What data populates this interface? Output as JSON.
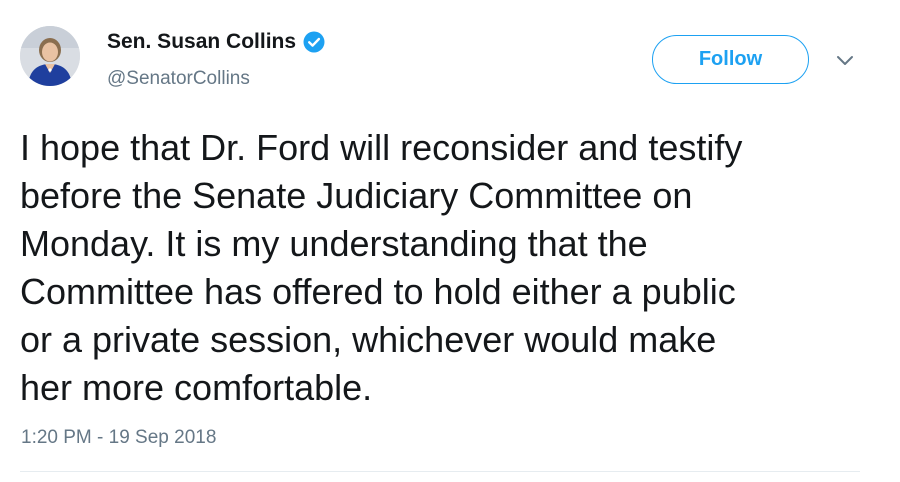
{
  "author": {
    "display_name": "Sen. Susan Collins",
    "handle": "@SenatorCollins",
    "verified": true,
    "avatar_icon": "profile-photo"
  },
  "actions": {
    "follow_label": "Follow",
    "more_icon": "chevron-down-icon"
  },
  "tweet": {
    "lines": [
      "I hope that Dr. Ford will reconsider and testify",
      "before the Senate Judiciary Committee on",
      "Monday. It is my understanding that the",
      "Committee has offered to hold either a public",
      "or a private session, whichever would make",
      "her more comfortable."
    ],
    "timestamp": "1:20 PM - 19 Sep 2018"
  },
  "colors": {
    "accent": "#1da1f2",
    "text": "#14171a",
    "secondary": "#657786",
    "divider": "#e6ecf0"
  }
}
